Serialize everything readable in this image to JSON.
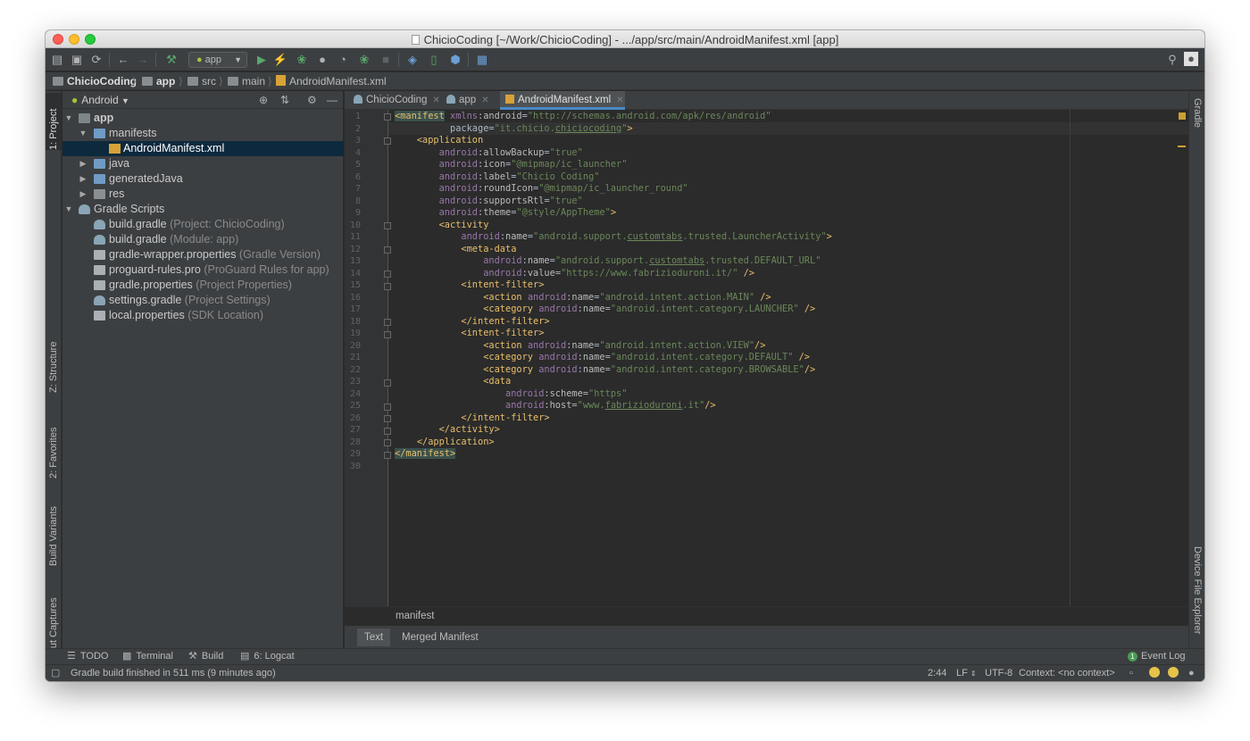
{
  "window": {
    "title": "ChicioCoding [~/Work/ChicioCoding] - .../app/src/main/AndroidManifest.xml [app]"
  },
  "toolbar": {
    "run_config": "app",
    "icons": [
      "open-icon",
      "save-icon",
      "sync-icon",
      "back-icon",
      "forward-icon",
      "build-hammer-icon",
      "run-icon",
      "apply-changes-icon",
      "debug-icon",
      "profile-icon",
      "attach-debugger-icon",
      "stop-icon",
      "gradle-sync-icon",
      "avd-manager-icon",
      "sdk-manager-icon",
      "project-structure-icon",
      "search-icon",
      "user-icon"
    ]
  },
  "navbar": {
    "crumbs": [
      "ChicioCoding",
      "app",
      "src",
      "main",
      "AndroidManifest.xml"
    ]
  },
  "left_stripe": {
    "tabs": [
      "1: Project",
      "Z: Structure",
      "2: Favorites",
      "Build Variants",
      "Layout Captures"
    ]
  },
  "right_stripe": {
    "tabs": [
      "Gradle",
      "Device File Explorer"
    ]
  },
  "project": {
    "view": "Android",
    "tree": [
      {
        "label": "app",
        "note": ""
      },
      {
        "label": "manifests",
        "note": ""
      },
      {
        "label": "AndroidManifest.xml",
        "note": ""
      },
      {
        "label": "java",
        "note": ""
      },
      {
        "label": "generatedJava",
        "note": ""
      },
      {
        "label": "res",
        "note": ""
      },
      {
        "label": "Gradle Scripts",
        "note": ""
      },
      {
        "label": "build.gradle",
        "note": " (Project: ChicioCoding)"
      },
      {
        "label": "build.gradle",
        "note": " (Module: app)"
      },
      {
        "label": "gradle-wrapper.properties",
        "note": " (Gradle Version)"
      },
      {
        "label": "proguard-rules.pro",
        "note": " (ProGuard Rules for app)"
      },
      {
        "label": "gradle.properties",
        "note": " (Project Properties)"
      },
      {
        "label": "settings.gradle",
        "note": " (Project Settings)"
      },
      {
        "label": "local.properties",
        "note": " (SDK Location)"
      }
    ]
  },
  "editor": {
    "tabs": [
      "ChicioCoding",
      "app",
      "AndroidManifest.xml"
    ],
    "line_numbers": [
      "1",
      "2",
      "3",
      "4",
      "5",
      "6",
      "7",
      "8",
      "9",
      "10",
      "11",
      "12",
      "13",
      "14",
      "15",
      "16",
      "17",
      "18",
      "19",
      "20",
      "21",
      "22",
      "23",
      "24",
      "25",
      "26",
      "27",
      "28",
      "29",
      "30"
    ],
    "breadcrumb": "manifest",
    "subtabs": [
      "Text",
      "Merged Manifest"
    ]
  },
  "tool_windows": {
    "todo": "TODO",
    "terminal": "Terminal",
    "build": "Build",
    "logcat": "6: Logcat",
    "event_log": "Event Log",
    "event_count": "1"
  },
  "status": {
    "message": "Gradle build finished in 511 ms (9 minutes ago)",
    "position": "2:44",
    "line_sep": "LF",
    "encoding": "UTF-8",
    "context": "Context: <no context>"
  },
  "colors": {
    "bg": "#2b2b2b",
    "panel": "#3c3f41",
    "tag": "#e8bf6a",
    "namespace": "#9876aa",
    "value": "#6a8759",
    "selection": "#0d293e",
    "accent": "#4a88c7"
  }
}
